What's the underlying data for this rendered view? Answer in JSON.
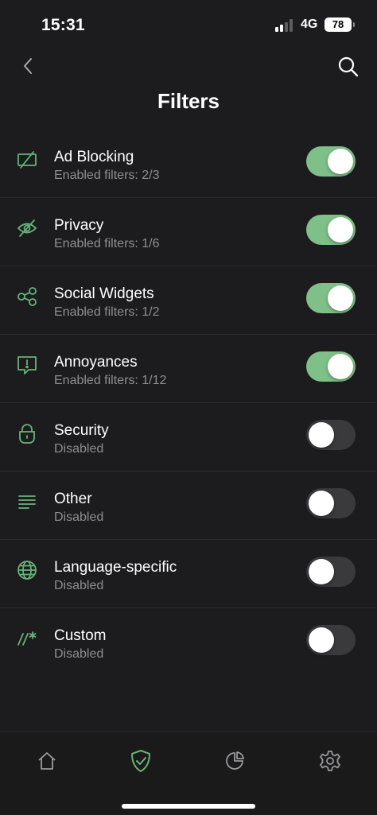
{
  "status_bar": {
    "time": "15:31",
    "network": "4G",
    "battery": "78"
  },
  "header": {
    "title": "Filters"
  },
  "filters": [
    {
      "name": "Ad Blocking",
      "subtitle": "Enabled filters: 2/3",
      "enabled": true,
      "icon": "ad-blocking-icon"
    },
    {
      "name": "Privacy",
      "subtitle": "Enabled filters: 1/6",
      "enabled": true,
      "icon": "privacy-eye-icon"
    },
    {
      "name": "Social Widgets",
      "subtitle": "Enabled filters: 1/2",
      "enabled": true,
      "icon": "share-icon"
    },
    {
      "name": "Annoyances",
      "subtitle": "Enabled filters: 1/12",
      "enabled": true,
      "icon": "alert-message-icon"
    },
    {
      "name": "Security",
      "subtitle": "Disabled",
      "enabled": false,
      "icon": "lock-icon"
    },
    {
      "name": "Other",
      "subtitle": "Disabled",
      "enabled": false,
      "icon": "lines-icon"
    },
    {
      "name": "Language-specific",
      "subtitle": "Disabled",
      "enabled": false,
      "icon": "globe-icon"
    },
    {
      "name": "Custom",
      "subtitle": "Disabled",
      "enabled": false,
      "icon": "custom-rules-icon"
    }
  ],
  "tab_bar": {
    "tabs": [
      "home-icon",
      "shield-check-icon",
      "statistics-icon",
      "settings-icon"
    ],
    "active": "shield-check-icon"
  },
  "colors": {
    "accent": "#67b279",
    "toggle_on": "#7fbf88",
    "toggle_off": "#3a3a3c",
    "background": "#1c1c1e",
    "subtitle": "#8e8e93"
  }
}
